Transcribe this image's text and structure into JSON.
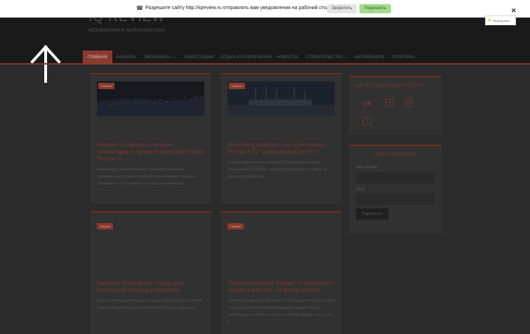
{
  "notification": {
    "text": "Разрешите сайту http://iqreview.ru отправлять вам уведомления на рабочий стол",
    "deny_label": "Запретить",
    "allow_label": "Разрешить",
    "close_glyph": "✕",
    "reading_badge": "Reading now..."
  },
  "site": {
    "logo": "IQ REVIEW",
    "tagline": "НЕЗАВИСИМАЯ ЖУРНАЛИСТИКА"
  },
  "nav": {
    "items": [
      {
        "label": "ГЛАВНАЯ"
      },
      {
        "label": "КАРЬЕРА"
      },
      {
        "label": "ЭКОНОМИКА ⌄"
      },
      {
        "label": "ИНВЕСТИЦИИ"
      },
      {
        "label": "ОТДЫХ И РАЗВЛЕЧЕНИЯ"
      },
      {
        "label": "НОВОСТИ"
      },
      {
        "label": "СТРОИТЕЛЬСТВО ⌄"
      },
      {
        "label": "АВТОМОБИЛИ"
      },
      {
        "label": "ПОЛИТИКА"
      }
    ]
  },
  "posts": [
    {
      "badge": "Главное",
      "title": "Абхазия сообщила о начале гуманитарных поставок электричества из России\"/>",
      "excerpt": "Новый Афон, Абхазия Россия с 21 декабря начинает гуманитарные поставки электричества в Абхазию, сообщает «Интерфакс» со ссылкой на и.о. президента Абхазии"
    },
    {
      "badge": "Главное",
      "title": "Bloomberg сообщил, что доля газа из России в ЕС снова начала расти\"/>",
      "excerpt": "Доля российского газа в импорте ЕС начала расти после сокращений с 2022 года, сообщает Bloomberg со ссылкой на данные Еврокомиссии."
    },
    {
      "badge": "Главное",
      "title": "Названы популярные города для новогодних поездок у пермяков",
      "excerpt": "Спрос на новогодние поездки в малые города России у жителей Перми и Пермского края относительно 2023 года вырос в 1,2"
    },
    {
      "badge": "Главное",
      "title": "Омская компания требует от кунгурского завода 3 млн руб. за бренд сосисок",
      "excerpt": "Зарегистрированное в Омске ООО «Сибирские колбасы» требует от кунгурского мясоперерабатывающего завода «Телец» компенсацию за незаконное использование бренда сосисок. Иск в"
    }
  ],
  "sidebar": {
    "social_title": "МЫ В СОЦИАЛЬНЫХ СЕТЯХ",
    "social": [
      "vk-icon",
      "facebook-icon",
      "odnoklassniki-icon",
      "rss-icon"
    ],
    "newsletter_title": "НАША РАССЫЛКА",
    "name_label": "Имя или ФИО",
    "email_label": "Email",
    "subscribe_label": "Подписаться"
  },
  "colors": {
    "accent": "#8c3a2e",
    "allow": "#a5d98a"
  }
}
